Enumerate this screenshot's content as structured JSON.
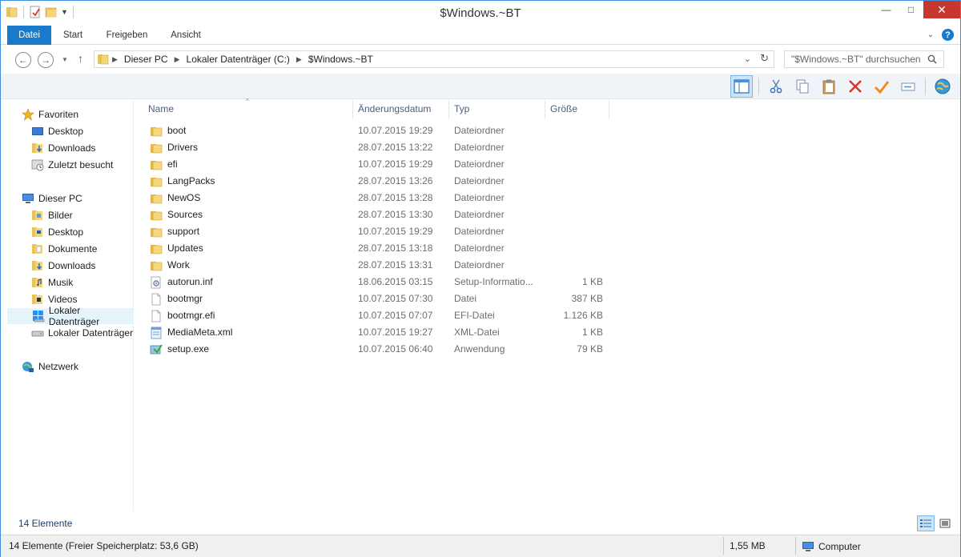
{
  "window": {
    "title": "$Windows.~BT"
  },
  "ribbon": {
    "tabs": [
      "Datei",
      "Start",
      "Freigeben",
      "Ansicht"
    ]
  },
  "address": {
    "crumbs": [
      "Dieser PC",
      "Lokaler Datenträger (C:)",
      "$Windows.~BT"
    ],
    "search_placeholder": "\"$Windows.~BT\" durchsuchen"
  },
  "nav": {
    "favorites": {
      "label": "Favoriten",
      "items": [
        "Desktop",
        "Downloads",
        "Zuletzt besucht"
      ]
    },
    "this_pc": {
      "label": "Dieser PC",
      "items": [
        "Bilder",
        "Desktop",
        "Dokumente",
        "Downloads",
        "Musik",
        "Videos",
        "Lokaler Datenträger",
        "Lokaler Datenträger"
      ]
    },
    "network": {
      "label": "Netzwerk"
    }
  },
  "columns": [
    "Name",
    "Änderungsdatum",
    "Typ",
    "Größe"
  ],
  "files": [
    {
      "name": "boot",
      "date": "10.07.2015 19:29",
      "type": "Dateiordner",
      "size": "",
      "icon": "folder"
    },
    {
      "name": "Drivers",
      "date": "28.07.2015 13:22",
      "type": "Dateiordner",
      "size": "",
      "icon": "folder"
    },
    {
      "name": "efi",
      "date": "10.07.2015 19:29",
      "type": "Dateiordner",
      "size": "",
      "icon": "folder"
    },
    {
      "name": "LangPacks",
      "date": "28.07.2015 13:26",
      "type": "Dateiordner",
      "size": "",
      "icon": "folder"
    },
    {
      "name": "NewOS",
      "date": "28.07.2015 13:28",
      "type": "Dateiordner",
      "size": "",
      "icon": "folder"
    },
    {
      "name": "Sources",
      "date": "28.07.2015 13:30",
      "type": "Dateiordner",
      "size": "",
      "icon": "folder"
    },
    {
      "name": "support",
      "date": "10.07.2015 19:29",
      "type": "Dateiordner",
      "size": "",
      "icon": "folder"
    },
    {
      "name": "Updates",
      "date": "28.07.2015 13:18",
      "type": "Dateiordner",
      "size": "",
      "icon": "folder"
    },
    {
      "name": "Work",
      "date": "28.07.2015 13:31",
      "type": "Dateiordner",
      "size": "",
      "icon": "folder"
    },
    {
      "name": "autorun.inf",
      "date": "18.06.2015 03:15",
      "type": "Setup-Informatio...",
      "size": "1 KB",
      "icon": "settings-file"
    },
    {
      "name": "bootmgr",
      "date": "10.07.2015 07:30",
      "type": "Datei",
      "size": "387 KB",
      "icon": "file"
    },
    {
      "name": "bootmgr.efi",
      "date": "10.07.2015 07:07",
      "type": "EFI-Datei",
      "size": "1.126 KB",
      "icon": "file"
    },
    {
      "name": "MediaMeta.xml",
      "date": "10.07.2015 19:27",
      "type": "XML-Datei",
      "size": "1 KB",
      "icon": "xml-file"
    },
    {
      "name": "setup.exe",
      "date": "10.07.2015 06:40",
      "type": "Anwendung",
      "size": "79 KB",
      "icon": "setup-exe"
    }
  ],
  "footer": {
    "item_count": "14 Elemente"
  },
  "status": {
    "left": "14 Elemente (Freier Speicherplatz: 53,6 GB)",
    "size": "1,55 MB",
    "location": "Computer"
  },
  "colors": {
    "accent": "#1979ca",
    "folder": "#e8c25a",
    "close": "#c7372f"
  }
}
